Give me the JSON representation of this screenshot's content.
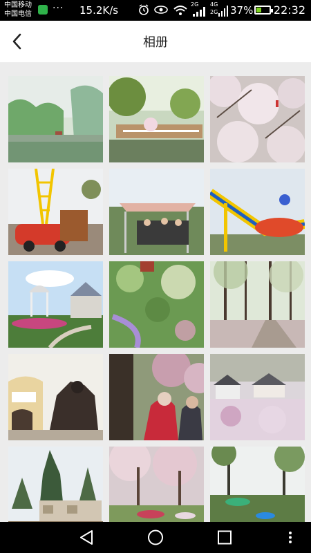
{
  "status_bar": {
    "carrier_1": "中国移动",
    "carrier_2": "中国电信",
    "net_speed": "15.2K/s",
    "signal_label_1": "2G",
    "signal_label_2": "4G",
    "signal_label_3": "2G",
    "battery_percent": "37%",
    "battery_level": 0.37,
    "time": "22:32"
  },
  "header": {
    "title": "相册",
    "back_icon": "chevron-left-icon"
  },
  "photos": [
    {
      "scene": "misty-lake"
    },
    {
      "scene": "garden-railing"
    },
    {
      "scene": "cherry-blossom-grove"
    },
    {
      "scene": "toy-train-playground"
    },
    {
      "scene": "tent-crowd"
    },
    {
      "scene": "amusement-ride"
    },
    {
      "scene": "pavilion-castle"
    },
    {
      "scene": "aerial-park"
    },
    {
      "scene": "forest-path"
    },
    {
      "scene": "gorilla-statue"
    },
    {
      "scene": "couple-photographers"
    },
    {
      "scene": "village-blossoms"
    },
    {
      "scene": "park-gate-sign"
    },
    {
      "scene": "blossom-picnic"
    },
    {
      "scene": "tall-trees-umbrellas"
    }
  ],
  "nav_bar": {
    "back_icon": "triangle-back-icon",
    "home_icon": "circle-home-icon",
    "recents_icon": "square-recents-icon",
    "menu_icon": "vertical-dots-icon"
  },
  "colors": {
    "background": "#ececec",
    "header": "#ffffff",
    "status_bar": "#000000",
    "battery_fill": "#7ed321"
  }
}
